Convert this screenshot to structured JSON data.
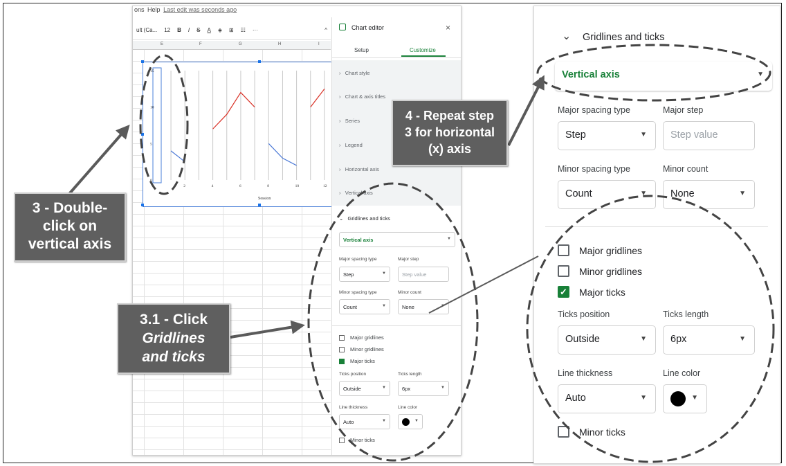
{
  "sheets": {
    "menu_help": "Help",
    "menu_last_edit": "Last edit was seconds ago",
    "menu_partial": "ons",
    "toolbar": {
      "font": "ult (Ca...",
      "font_size": "12",
      "bold": "B",
      "italic": "I",
      "strike": "S",
      "text_color": "A",
      "more": "···",
      "collapse": "^"
    },
    "columns": [
      "E",
      "F",
      "G",
      "H",
      "I"
    ]
  },
  "chart_data": {
    "type": "line",
    "xlabel": "Session",
    "x_ticks": [
      "2",
      "4",
      "6",
      "8",
      "10",
      "12"
    ],
    "y_ticks": [
      "0",
      "5",
      "10",
      "15"
    ],
    "ylim": [
      0,
      15
    ],
    "series": [
      {
        "color": "#d93025",
        "segments": [
          [
            [
              4,
              7
            ],
            [
              5,
              9
            ],
            [
              6,
              12
            ],
            [
              7,
              10
            ]
          ],
          [
            [
              11,
              10
            ],
            [
              12,
              12.5
            ]
          ]
        ]
      },
      {
        "color": "#4a78d6",
        "segments": [
          [
            [
              1,
              4
            ],
            [
              2,
              2.5
            ]
          ],
          [
            [
              8,
              5
            ],
            [
              9,
              3
            ],
            [
              10,
              2
            ]
          ]
        ]
      }
    ]
  },
  "editor": {
    "title": "Chart editor",
    "close": "×",
    "tabs": [
      "Setup",
      "Customize"
    ],
    "sections": [
      "Chart style",
      "Chart & axis titles",
      "Series",
      "Legend",
      "Horizontal axis",
      "Vertical axis"
    ],
    "gridlines_title": "Gridlines and ticks",
    "axis_select": "Vertical axis",
    "major_spacing_type_label": "Major spacing type",
    "major_spacing_type_value": "Step",
    "major_step_label": "Major step",
    "major_step_placeholder": "Step value",
    "minor_spacing_type_label": "Minor spacing type",
    "minor_spacing_type_value": "Count",
    "minor_count_label": "Minor count",
    "minor_count_value": "None",
    "major_gridlines": "Major gridlines",
    "minor_gridlines": "Minor gridlines",
    "major_ticks": "Major ticks",
    "ticks_position_label": "Ticks position",
    "ticks_position_value": "Outside",
    "ticks_length_label": "Ticks length",
    "ticks_length_value": "6px",
    "line_thickness_label": "Line thickness",
    "line_thickness_value": "Auto",
    "line_color_label": "Line color",
    "minor_ticks": "Minor ticks",
    "major_gridlines_checked": false,
    "minor_gridlines_checked": false,
    "major_ticks_checked": true,
    "minor_ticks_checked": false,
    "line_color": "#000000"
  },
  "callouts": {
    "step3_line1": "3 - Double-",
    "step3_line2": "click on",
    "step3_line3": "vertical axis",
    "step31_line1": "3.1 - Click",
    "step31_line2": "Gridlines",
    "step31_line3": "and ticks",
    "step4_line1": "4 - Repeat step",
    "step4_line2": "3 for horizontal",
    "step4_line3": "(x) axis"
  },
  "colors": {
    "accent_green": "#188038",
    "callout_bg": "#5f5f5f",
    "chart_blue": "#4a78d6",
    "chart_red": "#d93025"
  }
}
